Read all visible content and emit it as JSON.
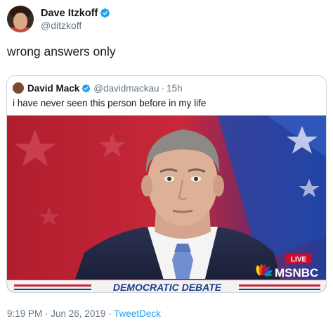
{
  "tweet": {
    "author": {
      "display_name": "Dave Itzkoff",
      "handle": "@ditzkoff",
      "verified": true
    },
    "text": "wrong answers only",
    "timestamp": "9:19 PM · Jun 26, 2019 · ",
    "source": "TweetDeck"
  },
  "quoted_tweet": {
    "author": {
      "display_name": "David Mack",
      "handle": "@davidmackau",
      "verified": true
    },
    "separator": "·",
    "time_ago": "15h",
    "text": "i have never seen this person before in my life",
    "media": {
      "live_badge": "LIVE",
      "network": "MSNBC",
      "banner": "DEMOCRATIC DEBATE"
    }
  },
  "colors": {
    "verified_blue": "#1da1f2",
    "link_blue": "#1da1f2",
    "muted_gray": "#657786",
    "live_red": "#c8102e",
    "banner_blue": "#1c3f8c"
  },
  "icons": [
    "verified-badge-icon",
    "msnbc-peacock-icon"
  ]
}
